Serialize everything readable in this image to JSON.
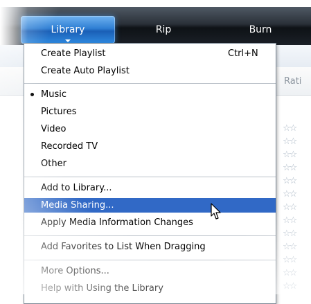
{
  "nav": {
    "tabs": [
      {
        "label": "Library",
        "selected": true
      },
      {
        "label": "Rip",
        "selected": false
      },
      {
        "label": "Burn",
        "selected": false
      }
    ]
  },
  "background": {
    "column_header": "Rati",
    "rating_icon": "empty-star-icon"
  },
  "menu": {
    "groups": [
      [
        {
          "label": "Create Playlist",
          "shortcut": "Ctrl+N"
        },
        {
          "label": "Create Auto Playlist"
        }
      ],
      [
        {
          "label": "Music",
          "checked": true
        },
        {
          "label": "Pictures"
        },
        {
          "label": "Video"
        },
        {
          "label": "Recorded TV"
        },
        {
          "label": "Other"
        }
      ],
      [
        {
          "label": "Add to Library..."
        },
        {
          "label": "Media Sharing...",
          "highlighted": true
        },
        {
          "label": "Apply Media Information Changes"
        }
      ],
      [
        {
          "label": "Add Favorites to List When Dragging"
        }
      ],
      [
        {
          "label": "More Options..."
        },
        {
          "label": "Help with Using the Library"
        }
      ]
    ]
  },
  "colors": {
    "selected_tab": "#2f7fd4",
    "menu_highlight": "#3169c6",
    "topbar": "#1b2027"
  }
}
